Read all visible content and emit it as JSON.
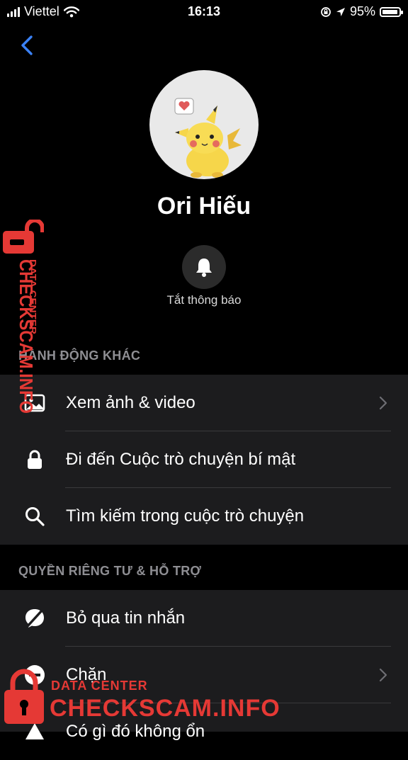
{
  "status_bar": {
    "carrier": "Viettel",
    "time": "16:13",
    "battery": "95%",
    "battery_level": 0.95,
    "icons": [
      "signal-icon",
      "wifi-icon",
      "rotation-lock-icon",
      "location-icon",
      "battery-icon"
    ]
  },
  "nav": {
    "back_icon": "chevron-left-icon"
  },
  "profile": {
    "name": "Ori Hiếu",
    "avatar_icon": "pikachu-avatar"
  },
  "mute": {
    "icon": "bell-icon",
    "label": "Tắt thông báo"
  },
  "sections": [
    {
      "title": "HÀNH ĐỘNG KHÁC",
      "items": [
        {
          "label": "Xem ảnh & video",
          "icon": "image-icon",
          "chevron": true
        },
        {
          "label": "Đi đến Cuộc trò chuyện bí mật",
          "icon": "lock-icon",
          "chevron": false
        },
        {
          "label": "Tìm kiếm trong cuộc trò chuyện",
          "icon": "search-icon",
          "chevron": false
        }
      ]
    },
    {
      "title": "QUYỀN RIÊNG TƯ & HỖ TRỢ",
      "items": [
        {
          "label": "Bỏ qua tin nhắn",
          "icon": "ignore-icon",
          "chevron": false
        },
        {
          "label": "Chặn",
          "icon": "block-icon",
          "chevron": true
        },
        {
          "label": "Có gì đó không ổn",
          "icon": "warning-icon",
          "chevron": false
        }
      ]
    }
  ],
  "watermark": {
    "data_center": "DATA CENTER",
    "checkscam": "CHECKSCAM.INFO",
    "color": "#e53935"
  },
  "colors": {
    "accent": "#3b82f6",
    "background": "#000000",
    "group_bg": "#1c1c1e"
  }
}
